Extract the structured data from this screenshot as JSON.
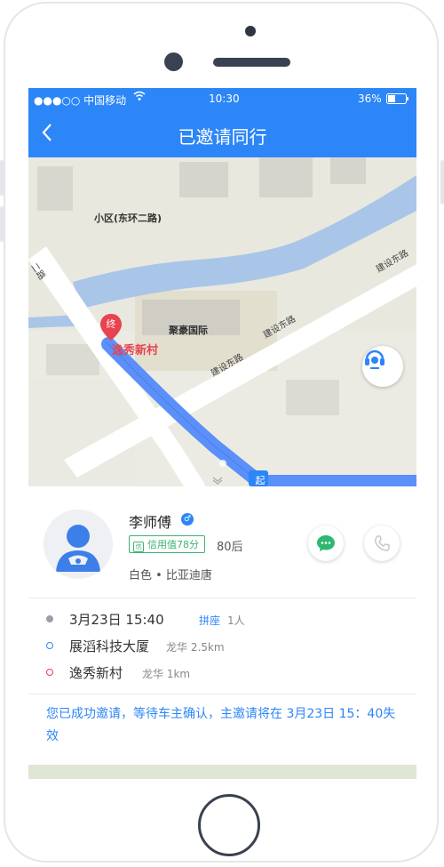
{
  "status_bar": {
    "carrier": "●●●○○ 中国移动",
    "time": "10:30",
    "battery": "36%"
  },
  "nav": {
    "back_icon": "chevron-left-icon",
    "title": "已邀请同行"
  },
  "map": {
    "labels": {
      "community": "小区(东环二路)",
      "juhao": "聚豪国际",
      "destination": "逸秀新村",
      "end_marker": "终",
      "road_jianshe_upper": "建设东路",
      "road_jianshe_mid": "建设东路",
      "road_jianshe_lower": "建设东路",
      "road_er": "二路",
      "start_marker": "起"
    },
    "colors": {
      "route": "#5b8ff9",
      "river": "#a9c6e8",
      "road": "#ffffff",
      "marker": "#e8434f"
    },
    "cs_icon": "headset-icon"
  },
  "driver": {
    "name": "李师傅",
    "gender_icon": "male-icon",
    "credit": "信用值78分",
    "age": "80后",
    "car": "白色 • 比亚迪唐",
    "message_icon": "message-icon",
    "phone_icon": "phone-icon"
  },
  "trip": {
    "time": "3月23日  15:40",
    "carpool_label": "拼座",
    "carpool_count": "1人",
    "start_name": "展滔科技大厦",
    "start_detail": "龙华 2.5km",
    "end_name": "逸秀新村",
    "end_detail": "龙华 1km"
  },
  "notice": "您已成功邀请，等待车主确认，主邀请将在 3月23日 15：40失效"
}
